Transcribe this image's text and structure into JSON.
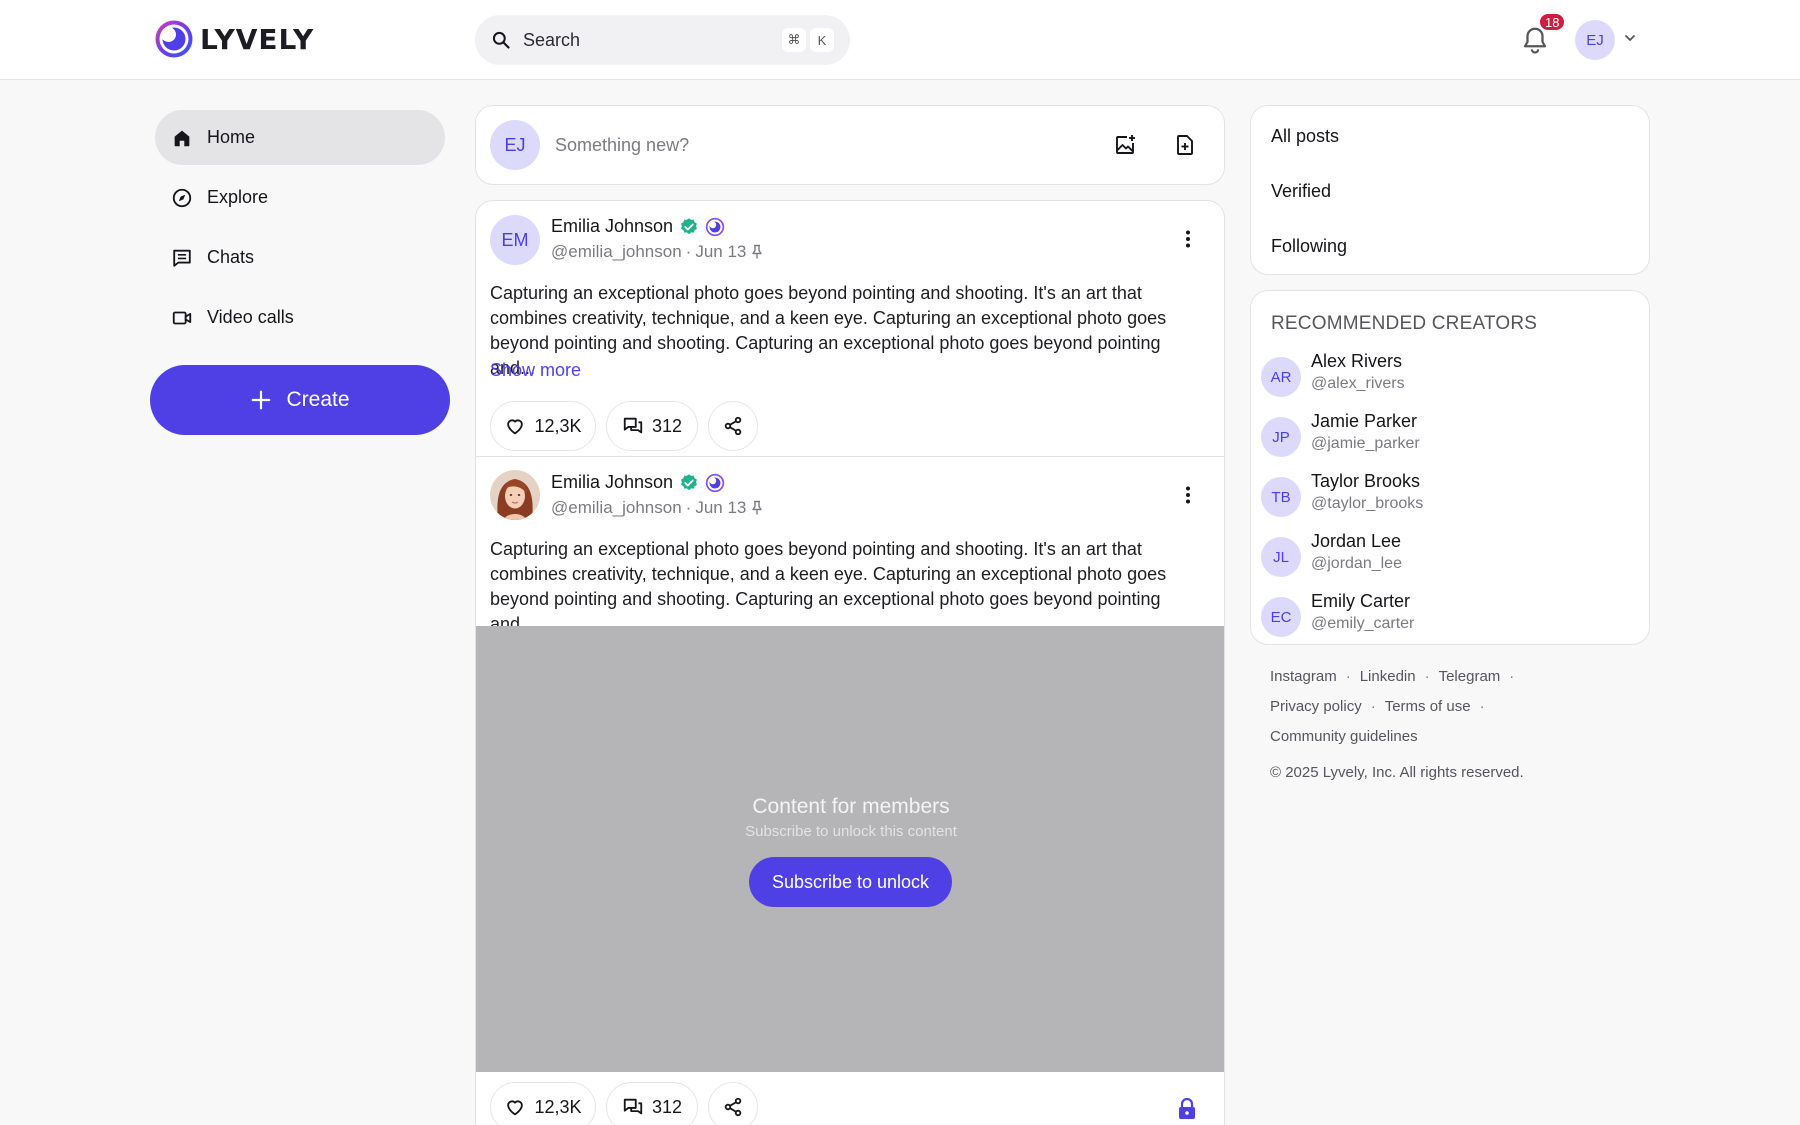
{
  "header": {
    "logo_text": "LYVELY",
    "search_placeholder": "Search",
    "shortcut_keys": [
      "⌘",
      "K"
    ],
    "notification_count": "18",
    "user_initials": "EJ"
  },
  "nav": {
    "items": [
      {
        "label": "Home",
        "icon": "home-icon",
        "active": true
      },
      {
        "label": "Explore",
        "icon": "compass-icon"
      },
      {
        "label": "Chats",
        "icon": "chat-icon"
      },
      {
        "label": "Video calls",
        "icon": "video-icon"
      }
    ],
    "create_label": "Create"
  },
  "composer": {
    "avatar_initials": "EJ",
    "placeholder": "Something new?"
  },
  "posts": [
    {
      "avatar_initials": "EM",
      "author": "Emilia Johnson",
      "handle": "@emilia_johnson",
      "date": "Jun 13",
      "text": "Capturing an exceptional photo goes beyond pointing and shooting. It's an art that combines creativity, technique, and a keen eye. Capturing an exceptional photo goes beyond pointing and shooting. Capturing an exceptional photo goes beyond pointing and...",
      "show_more": "Show more",
      "likes": "12,3K",
      "comments": "312"
    },
    {
      "author": "Emilia Johnson",
      "handle": "@emilia_johnson",
      "date": "Jun 13",
      "text": "Capturing an exceptional photo goes beyond pointing and shooting. It's an art that combines creativity, technique, and a keen eye. Capturing an exceptional photo goes beyond pointing and shooting. Capturing an exceptional photo goes beyond pointing and...",
      "locked_title": "Content for members",
      "locked_subtitle": "Subscribe to unlock this content",
      "unlock_label": "Subscribe to unlock",
      "likes": "12,3K",
      "comments": "312"
    }
  ],
  "filters": [
    "All posts",
    "Verified",
    "Following"
  ],
  "recommended": {
    "title": "RECOMMENDED CREATORS",
    "creators": [
      {
        "initials": "AR",
        "name": "Alex Rivers",
        "handle": "@alex_rivers"
      },
      {
        "initials": "JP",
        "name": "Jamie Parker",
        "handle": "@jamie_parker"
      },
      {
        "initials": "TB",
        "name": "Taylor Brooks",
        "handle": "@taylor_brooks"
      },
      {
        "initials": "JL",
        "name": "Jordan Lee",
        "handle": "@jordan_lee"
      },
      {
        "initials": "EC",
        "name": "Emily Carter",
        "handle": "@emily_carter"
      }
    ]
  },
  "footer": {
    "links": [
      "Instagram",
      "Linkedin",
      "Telegram",
      "Privacy policy",
      "Terms of use",
      "Community guidelines"
    ],
    "copyright": "© 2025 Lyvely, Inc. All rights reserved."
  },
  "colors": {
    "accent": "#4f40e6",
    "avatar_bg": "#ddd9fb",
    "badge": "#d01c3f",
    "verified": "#1fb28c"
  }
}
